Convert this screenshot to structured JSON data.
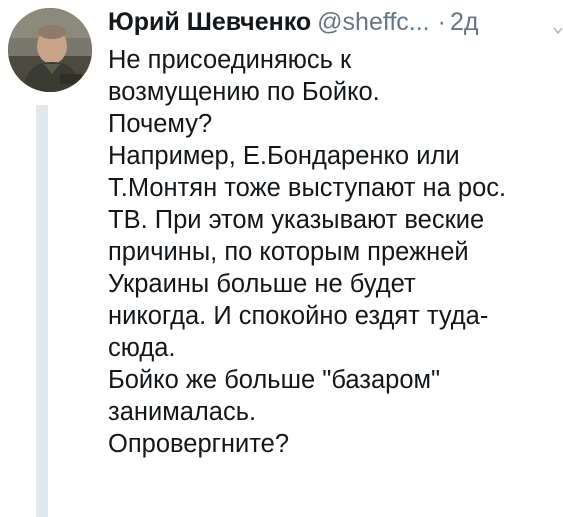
{
  "tweet": {
    "author": {
      "name": "Юрий Шевченко",
      "handle": "@sheffc...",
      "separator": "·",
      "time": "2д"
    },
    "lines": [
      "Не присоединяюсь к",
      "возмущению по Бойко.",
      "Почему?",
      "Например, Е.Бондаренко или",
      "Т.Монтян тоже выступают на рос.",
      "ТВ. При этом указывают веские",
      "причины, по которым прежней",
      "Украины больше не будет",
      "никогда. И спокойно ездят туда-",
      "сюда.",
      "Бойко же больше \"базаром\"",
      "занималась.",
      "Опровергните?"
    ]
  },
  "icons": {
    "more": "chevron-down-icon"
  },
  "colors": {
    "text": "#14171a",
    "secondary": "#657786",
    "thread_line": "#e1e8ed"
  }
}
